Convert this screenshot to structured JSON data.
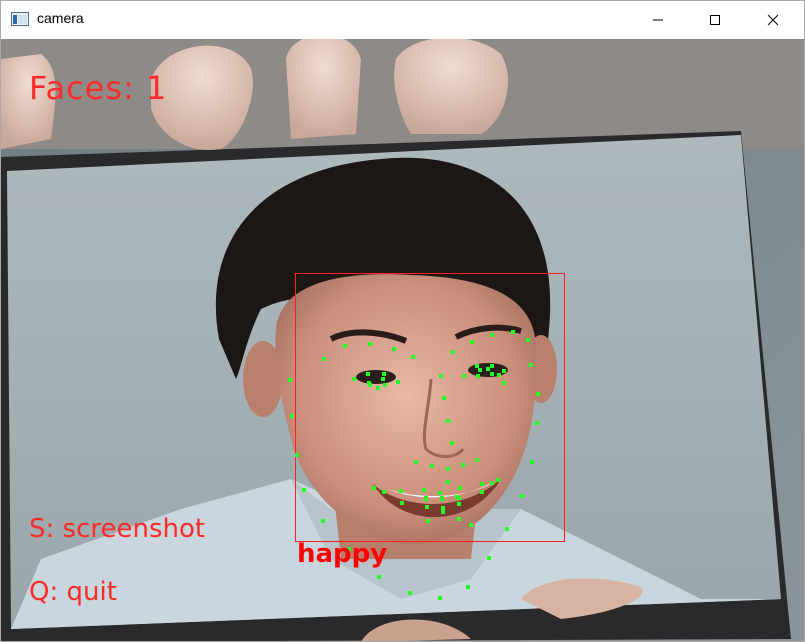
{
  "window": {
    "title": "camera",
    "controls": {
      "minimize": "minimize-icon",
      "maximize": "maximize-icon",
      "close": "close-icon"
    }
  },
  "overlay": {
    "faces_text": "Faces: 1",
    "hint_screenshot": "S: screenshot",
    "hint_quit": "Q: quit",
    "emotion": "happy",
    "colors": {
      "text": "#ff2a2a",
      "box": "#ff2020",
      "landmark": "#22ff22"
    }
  }
}
